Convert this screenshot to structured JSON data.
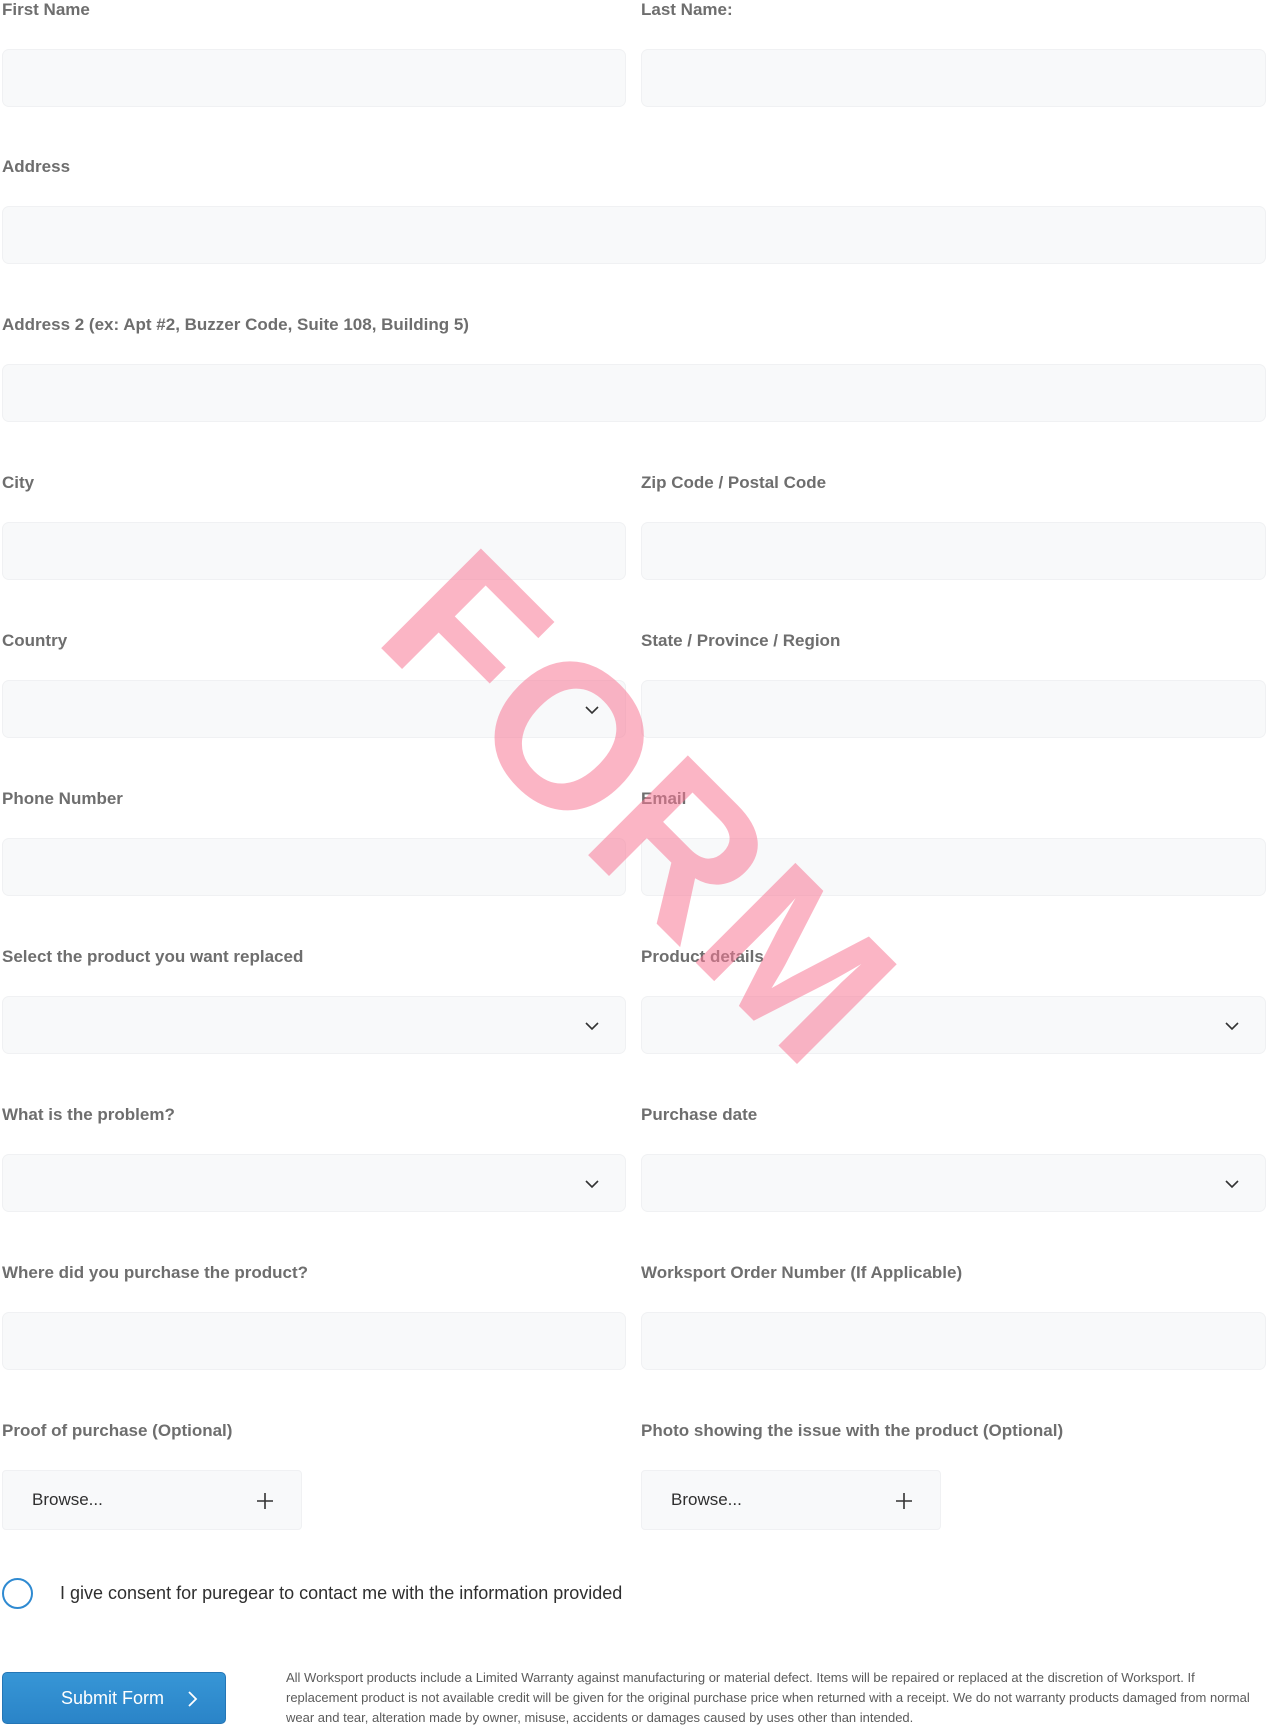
{
  "fields": {
    "first_name": {
      "label": "First Name",
      "value": ""
    },
    "last_name": {
      "label": "Last Name:",
      "value": ""
    },
    "address": {
      "label": "Address",
      "value": ""
    },
    "address2": {
      "label": "Address 2 (ex: Apt #2, Buzzer Code, Suite 108, Building 5)",
      "value": ""
    },
    "city": {
      "label": "City",
      "value": ""
    },
    "zip": {
      "label": "Zip Code / Postal Code",
      "value": ""
    },
    "country": {
      "label": "Country",
      "value": ""
    },
    "state": {
      "label": "State / Province / Region",
      "value": ""
    },
    "phone": {
      "label": "Phone Number",
      "value": ""
    },
    "email": {
      "label": "Email",
      "value": ""
    },
    "product": {
      "label": "Select the product you want replaced",
      "value": ""
    },
    "product_details": {
      "label": "Product details",
      "value": ""
    },
    "problem": {
      "label": "What is the problem?",
      "value": ""
    },
    "purchase_date": {
      "label": "Purchase date",
      "value": ""
    },
    "purchase_place": {
      "label": "Where did you purchase the product?",
      "value": ""
    },
    "order_number": {
      "label": "Worksport Order Number (If Applicable)",
      "value": ""
    }
  },
  "uploads": {
    "proof": {
      "label": "Proof of purchase (Optional)",
      "button": "Browse..."
    },
    "photo": {
      "label": "Photo showing the issue with the product (Optional)",
      "button": "Browse..."
    }
  },
  "consent": {
    "label": "I give consent for puregear to contact me with the information provided",
    "checked": false
  },
  "submit": {
    "label": "Submit Form"
  },
  "disclaimer": "All Worksport products include a Limited Warranty against manufacturing or material defect. Items will be repaired or replaced at the discretion of Worksport. If replacement product is not available credit will be given for the original purchase price when returned with a receipt. We do not warranty products damaged from normal wear and tear, alteration made by owner, misuse, accidents or damages caused by uses other than intended.",
  "watermark": "FORM",
  "icons": {
    "dropdown": "chevron-down-icon",
    "upload": "plus-icon",
    "submit": "chevron-right-icon"
  },
  "colors": {
    "accent": "#2f8ad1",
    "field_bg": "#f8f9fa",
    "watermark": "#f77896"
  }
}
